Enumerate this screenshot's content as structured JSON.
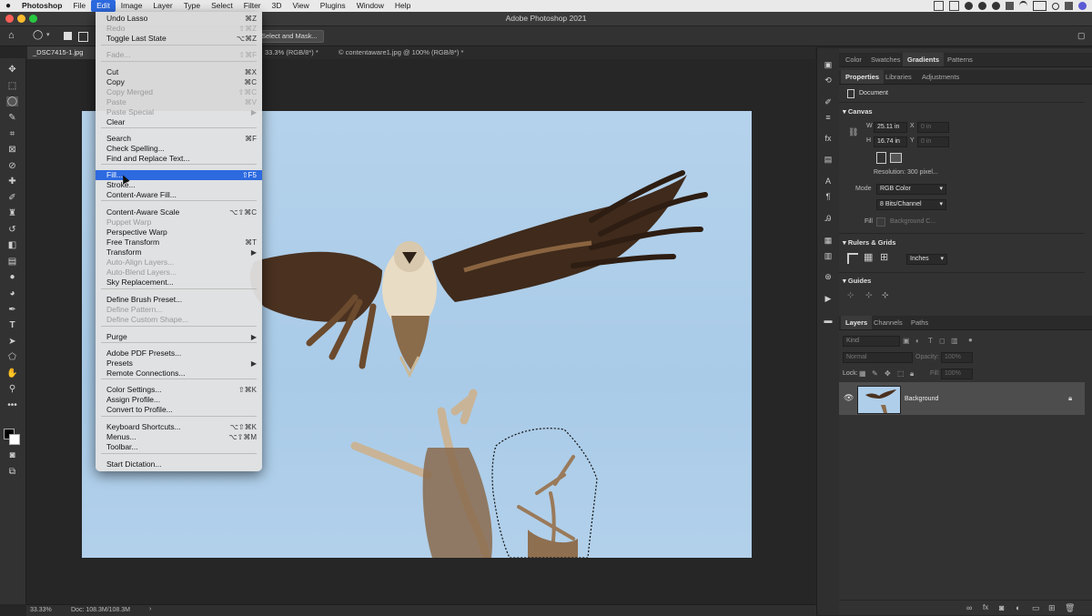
{
  "menubar": {
    "app": "Photoshop",
    "items": [
      "File",
      "Edit",
      "Image",
      "Layer",
      "Type",
      "Select",
      "Filter",
      "3D",
      "View",
      "Plugins",
      "Window",
      "Help"
    ]
  },
  "titlebar": {
    "title": "Adobe Photoshop 2021"
  },
  "options": {
    "select_mask": "Select and Mask..."
  },
  "tabs": [
    {
      "label": "_DSC7415-1.jpg"
    },
    {
      "label": "33.3% (RGB/8*) *"
    },
    {
      "label": "© contentaware1.jpg @ 100% (RGB/8*) *"
    }
  ],
  "edit_menu": [
    {
      "label": "Undo Lasso",
      "shortcut": "⌘Z",
      "enabled": true
    },
    {
      "label": "Redo",
      "shortcut": "⇧⌘Z",
      "enabled": false
    },
    {
      "label": "Toggle Last State",
      "shortcut": "⌥⌘Z",
      "enabled": true
    },
    {
      "label": "Fade...",
      "shortcut": "⇧⌘F",
      "enabled": false
    },
    {
      "label": "Cut",
      "shortcut": "⌘X",
      "enabled": true
    },
    {
      "label": "Copy",
      "shortcut": "⌘C",
      "enabled": true
    },
    {
      "label": "Copy Merged",
      "shortcut": "⇧⌘C",
      "enabled": false
    },
    {
      "label": "Paste",
      "shortcut": "⌘V",
      "enabled": false
    },
    {
      "label": "Paste Special",
      "shortcut": "▶",
      "enabled": false
    },
    {
      "label": "Clear",
      "shortcut": "",
      "enabled": true
    },
    {
      "label": "Search",
      "shortcut": "⌘F",
      "enabled": true
    },
    {
      "label": "Check Spelling...",
      "shortcut": "",
      "enabled": true
    },
    {
      "label": "Find and Replace Text...",
      "shortcut": "",
      "enabled": true
    },
    {
      "label": "Fill...",
      "shortcut": "⇧F5",
      "enabled": true,
      "highlighted": true
    },
    {
      "label": "Stroke...",
      "shortcut": "",
      "enabled": true
    },
    {
      "label": "Content-Aware Fill...",
      "shortcut": "",
      "enabled": true
    },
    {
      "label": "Content-Aware Scale",
      "shortcut": "⌥⇧⌘C",
      "enabled": true
    },
    {
      "label": "Puppet Warp",
      "shortcut": "",
      "enabled": false
    },
    {
      "label": "Perspective Warp",
      "shortcut": "",
      "enabled": true
    },
    {
      "label": "Free Transform",
      "shortcut": "⌘T",
      "enabled": true
    },
    {
      "label": "Transform",
      "shortcut": "▶",
      "enabled": true
    },
    {
      "label": "Auto-Align Layers...",
      "shortcut": "",
      "enabled": false
    },
    {
      "label": "Auto-Blend Layers...",
      "shortcut": "",
      "enabled": false
    },
    {
      "label": "Sky Replacement...",
      "shortcut": "",
      "enabled": true
    },
    {
      "label": "Define Brush Preset...",
      "shortcut": "",
      "enabled": true
    },
    {
      "label": "Define Pattern...",
      "shortcut": "",
      "enabled": false
    },
    {
      "label": "Define Custom Shape...",
      "shortcut": "",
      "enabled": false
    },
    {
      "label": "Purge",
      "shortcut": "▶",
      "enabled": true
    },
    {
      "label": "Adobe PDF Presets...",
      "shortcut": "",
      "enabled": true
    },
    {
      "label": "Presets",
      "shortcut": "▶",
      "enabled": true
    },
    {
      "label": "Remote Connections...",
      "shortcut": "",
      "enabled": true
    },
    {
      "label": "Color Settings...",
      "shortcut": "⇧⌘K",
      "enabled": true
    },
    {
      "label": "Assign Profile...",
      "shortcut": "",
      "enabled": true
    },
    {
      "label": "Convert to Profile...",
      "shortcut": "",
      "enabled": true
    },
    {
      "label": "Keyboard Shortcuts...",
      "shortcut": "⌥⇧⌘K",
      "enabled": true
    },
    {
      "label": "Menus...",
      "shortcut": "⌥⇧⌘M",
      "enabled": true
    },
    {
      "label": "Toolbar...",
      "shortcut": "",
      "enabled": true
    },
    {
      "label": "Start Dictation...",
      "shortcut": "",
      "enabled": true
    }
  ],
  "panels": {
    "top_tabs": [
      "Color",
      "Swatches",
      "Gradients",
      "Patterns"
    ],
    "top_active": "Gradients",
    "prop_tabs": [
      "Properties",
      "Libraries",
      "Adjustments"
    ],
    "prop_active": "Properties",
    "document_label": "Document",
    "canvas": {
      "title": "Canvas",
      "w_label": "W",
      "w_value": "25.11 in",
      "h_label": "H",
      "h_value": "16.74 in",
      "x_label": "X",
      "x_value": "0 in",
      "y_label": "Y",
      "y_value": "0 in",
      "resolution": "Resolution: 300 pixel...",
      "mode_label": "Mode",
      "mode_value": "RGB Color",
      "bits_value": "8 Bits/Channel",
      "fill_label": "Fill",
      "fill_value": "Background C..."
    },
    "rulers": {
      "title": "Rulers & Grids",
      "units": "Inches"
    },
    "guides": {
      "title": "Guides"
    },
    "layer_tabs": [
      "Layers",
      "Channels",
      "Paths"
    ],
    "layer_active": "Layers",
    "kind": "Kind",
    "blend_mode": "Normal",
    "opacity_label": "Opacity:",
    "opacity_value": "100%",
    "lock_label": "Lock:",
    "fill_label": "Fill:",
    "fill_value": "100%",
    "layer_name": "Background"
  },
  "status": {
    "zoom": "33.33%",
    "doc": "Doc: 108.3M/108.3M"
  },
  "colors": {
    "accent": "#2d6ae0",
    "sky": "#afcee9",
    "panel": "#323232"
  }
}
